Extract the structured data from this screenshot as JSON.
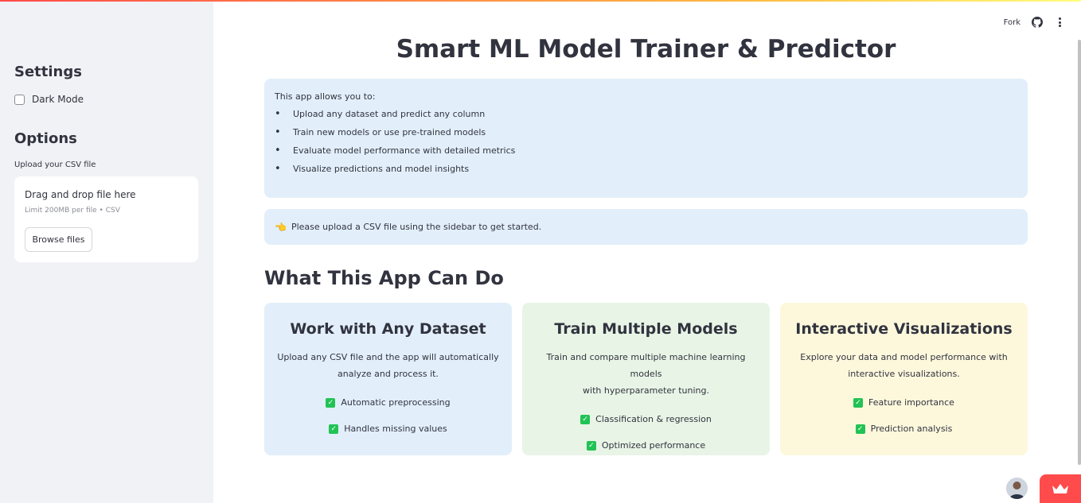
{
  "sidebar": {
    "settings_heading": "Settings",
    "dark_mode_label": "Dark Mode",
    "dark_mode_checked": false,
    "options_heading": "Options",
    "upload_label": "Upload your CSV file",
    "dropzone_title": "Drag and drop file here",
    "dropzone_limit": "Limit 200MB per file • CSV",
    "browse_label": "Browse files"
  },
  "toolbar": {
    "fork_label": "Fork",
    "github_icon": "github-icon",
    "menu_icon": "more-vertical-icon"
  },
  "main": {
    "title": "Smart ML Model Trainer & Predictor",
    "info_intro": "This app allows you to:",
    "info_items": [
      "Upload any dataset and predict any column",
      "Train new models or use pre-trained models",
      "Evaluate model performance with detailed metrics",
      "Visualize predictions and model insights"
    ],
    "notice_icon": "👈",
    "notice_text": "Please upload a CSV file using the sidebar to get started.",
    "section_title": "What This App Can Do",
    "cards": [
      {
        "title": "Work with Any Dataset",
        "desc_line1": "Upload any CSV file and the app will automatically",
        "desc_line2": "analyze and process it.",
        "features": [
          "Automatic preprocessing",
          "Handles missing values"
        ],
        "bg": "#e2effa"
      },
      {
        "title": "Train Multiple Models",
        "desc_line1": "Train and compare multiple machine learning models",
        "desc_line2": "with hyperparameter tuning.",
        "features": [
          "Classification & regression",
          "Optimized performance"
        ],
        "bg": "#e8f5e6"
      },
      {
        "title": "Interactive Visualizations",
        "desc_line1": "Explore your data and model performance with",
        "desc_line2": "interactive visualizations.",
        "features": [
          "Feature importance",
          "Prediction analysis"
        ],
        "bg": "#fdf8dc"
      }
    ]
  },
  "colors": {
    "accent": "#ff4b4b",
    "check": "#21c354",
    "sidebar_bg": "#f0f2f6",
    "info_bg": "#e2effa"
  }
}
